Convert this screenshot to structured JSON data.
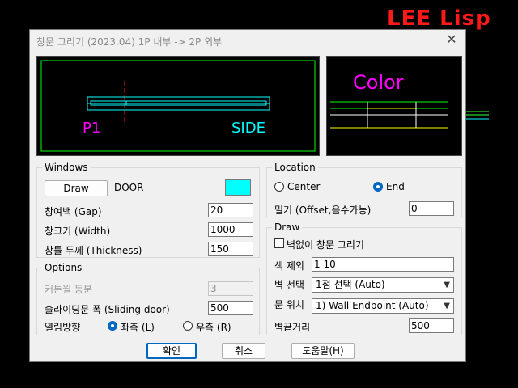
{
  "brand": "LEE Lisp",
  "dialog": {
    "title": "창문 그리기 (2023.04)   1P 내부 -> 2P 외부",
    "close": "✕"
  },
  "preview_main": {
    "left_text": "P1",
    "right_text": "SIDE"
  },
  "preview_color": {
    "text": "Color"
  },
  "windows": {
    "group_label": "Windows",
    "draw_button": "Draw",
    "door_label": "DOOR",
    "color_swatch": "#00ffff",
    "gap_label": "창여백 (Gap)",
    "gap_value": "20",
    "width_label": "창크기 (Width)",
    "width_value": "1000",
    "thickness_label": "창틀 두께 (Thickness)",
    "thickness_value": "150"
  },
  "options": {
    "group_label": "Options",
    "curtain_label": "커튼월 등분",
    "curtain_value": "3",
    "sliding_label": "슬라이딩문 폭 (Sliding door)",
    "sliding_value": "500",
    "open_dir_label": "열림방향",
    "left_label": "좌측 (L)",
    "right_label": "우측 (R)",
    "selected": "left"
  },
  "location": {
    "group_label": "Location",
    "center_label": "Center",
    "end_label": "End",
    "selected": "end",
    "offset_label": "밀기 (Offset,음수가능)",
    "offset_value": "0"
  },
  "draw": {
    "group_label": "Draw",
    "no_wall_label": "벽없이 창문 그리기",
    "no_wall_checked": false,
    "exclude_color_label": "색 제외",
    "exclude_color_value": "1 10",
    "wall_select_label": "벽 선택",
    "wall_select_value": "1점 선택 (Auto)",
    "door_pos_label": "문 위치",
    "door_pos_value": "1) Wall Endpoint (Auto)",
    "wall_end_dist_label": "벽끝거리",
    "wall_end_dist_value": "500"
  },
  "footer": {
    "ok": "확인",
    "cancel": "취소",
    "help": "도움말(H)"
  }
}
